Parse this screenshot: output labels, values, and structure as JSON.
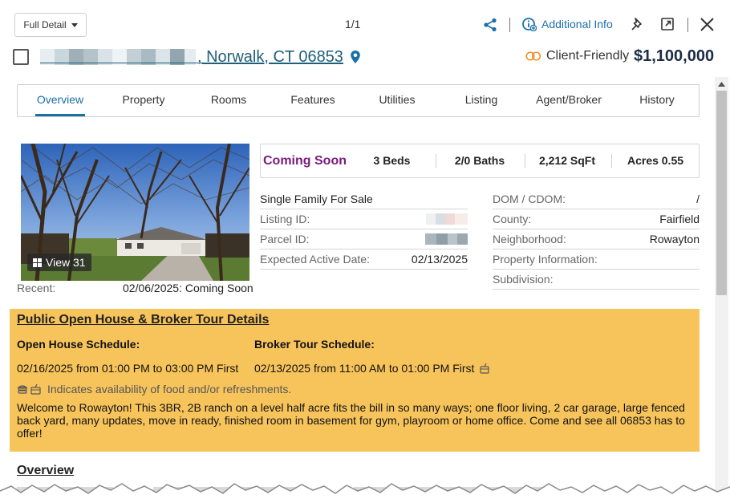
{
  "toolbar": {
    "view_label": "Full Detail",
    "pager": "1/1",
    "additional_info": "Additional Info"
  },
  "header": {
    "address_text": ", Norwalk, CT 06853",
    "client_friendly_label": "Client-Friendly",
    "price": "$1,100,000"
  },
  "tabs": [
    {
      "label": "Overview"
    },
    {
      "label": "Property"
    },
    {
      "label": "Rooms"
    },
    {
      "label": "Features"
    },
    {
      "label": "Utilities"
    },
    {
      "label": "Listing"
    },
    {
      "label": "Agent/Broker"
    },
    {
      "label": "History"
    }
  ],
  "photo": {
    "view_label": "View 31"
  },
  "recent": {
    "label": "Recent:",
    "value": "02/06/2025: Coming Soon"
  },
  "stats": {
    "status": "Coming Soon",
    "beds": "3 Beds",
    "baths": "2/0 Baths",
    "sqft": "2,212 SqFt",
    "acres": "Acres 0.55"
  },
  "details_left": {
    "property_type": "Single Family For Sale",
    "listing_id_label": "Listing ID:",
    "parcel_id_label": "Parcel ID:",
    "expected_active_label": "Expected Active Date:",
    "expected_active_value": "02/13/2025"
  },
  "details_right": {
    "dom_label": "DOM / CDOM:",
    "dom_value": "/",
    "county_label": "County:",
    "county_value": "Fairfield",
    "neighborhood_label": "Neighborhood:",
    "neighborhood_value": "Rowayton",
    "property_info_label": "Property Information:",
    "subdivision_label": "Subdivision:"
  },
  "open_house": {
    "title": "Public Open House & Broker Tour Details",
    "oh_schedule_label": "Open House Schedule:",
    "oh_schedule_value": "02/16/2025 from 01:00 PM to 03:00 PM First",
    "broker_schedule_label": "Broker Tour Schedule:",
    "broker_schedule_value": "02/13/2025 from 11:00 AM to 01:00 PM First",
    "food_note": "Indicates availability of food and/or refreshments.",
    "description": "Welcome to Rowayton! This 3BR, 2B ranch on a level half acre fits the bill in so many ways; one floor living, 2 car garage, large fenced back yard, many updates, move in ready, finished room in basement for gym, playroom or home office. Come and see all 06853 has to offer!"
  },
  "overview": {
    "heading": "Overview"
  },
  "colors": {
    "accent": "#1a6fa8",
    "status_purple": "#7b1a7e",
    "open_house_bg": "#f7c45c",
    "address_link": "#1f5f7a",
    "price": "#1c2c44"
  }
}
